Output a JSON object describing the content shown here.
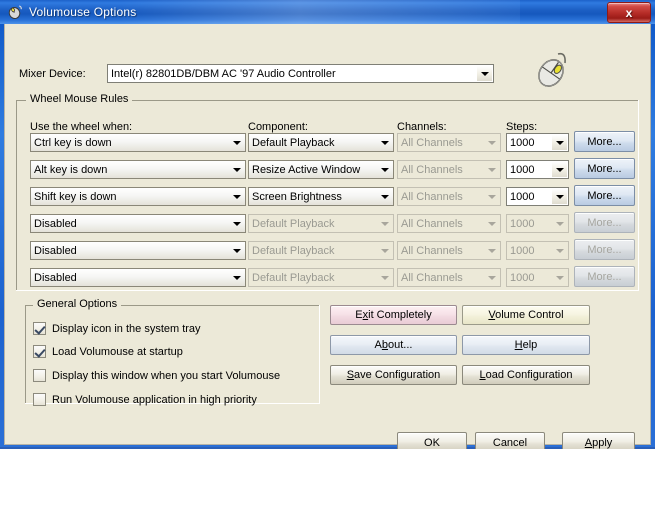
{
  "window": {
    "title": "Volumouse Options",
    "icon": "volumouse-mouse-icon",
    "close_label": "x"
  },
  "mixer": {
    "label": "Mixer Device:",
    "value": "Intel(r) 82801DB/DBM AC '97 Audio Controller",
    "decoration_icon": "mouse-wheel-illustration"
  },
  "wheel_rules": {
    "group_title": "Wheel Mouse Rules",
    "headers": {
      "condition": "Use the wheel when:",
      "component": "Component:",
      "channels": "Channels:",
      "steps": "Steps:"
    },
    "more_label": "More...",
    "rows": [
      {
        "condition": "Ctrl key is down",
        "component": "Default Playback",
        "channels": "All Channels",
        "steps": "1000",
        "enabled": true
      },
      {
        "condition": "Alt key is down",
        "component": "Resize Active Window",
        "channels": "All Channels",
        "steps": "1000",
        "enabled": true
      },
      {
        "condition": "Shift key is down",
        "component": "Screen Brightness",
        "channels": "All Channels",
        "steps": "1000",
        "enabled": true
      },
      {
        "condition": "Disabled",
        "component": "Default Playback",
        "channels": "All Channels",
        "steps": "1000",
        "enabled": false
      },
      {
        "condition": "Disabled",
        "component": "Default Playback",
        "channels": "All Channels",
        "steps": "1000",
        "enabled": false
      },
      {
        "condition": "Disabled",
        "component": "Default Playback",
        "channels": "All Channels",
        "steps": "1000",
        "enabled": false
      }
    ]
  },
  "general_options": {
    "group_title": "General Options",
    "checkboxes": [
      {
        "label": "Display icon in the system tray",
        "checked": true
      },
      {
        "label": "Load Volumouse at startup",
        "checked": true
      },
      {
        "label": "Display this window when you start Volumouse",
        "checked": false
      },
      {
        "label": "Run Volumouse application in high priority",
        "checked": false
      }
    ]
  },
  "action_buttons": {
    "exit_completely": {
      "label": "Exit Completely",
      "accel": "x",
      "color": "#f7e2e8"
    },
    "volume_control": {
      "label": "Volume Control",
      "accel": "V",
      "color": "#f7f5e2"
    },
    "about": {
      "label": "About...",
      "accel": "b",
      "color": "#e9eef5"
    },
    "help": {
      "label": "Help",
      "accel": "H",
      "color": "#e9eef5"
    },
    "save_configuration": {
      "label": "Save Configuration",
      "accel": "S",
      "color": "#f0eee4"
    },
    "load_configuration": {
      "label": "Load Configuration",
      "accel": "L",
      "color": "#f0eee4"
    }
  },
  "dialog_buttons": {
    "ok": "OK",
    "cancel": "Cancel",
    "apply": "Apply",
    "apply_accel": "A"
  },
  "colors": {
    "titlebar_blue": "#1c5fc4",
    "client_bg": "#ece9d8",
    "close_red": "#b42b26",
    "more_button_blue": "#cddbec"
  }
}
